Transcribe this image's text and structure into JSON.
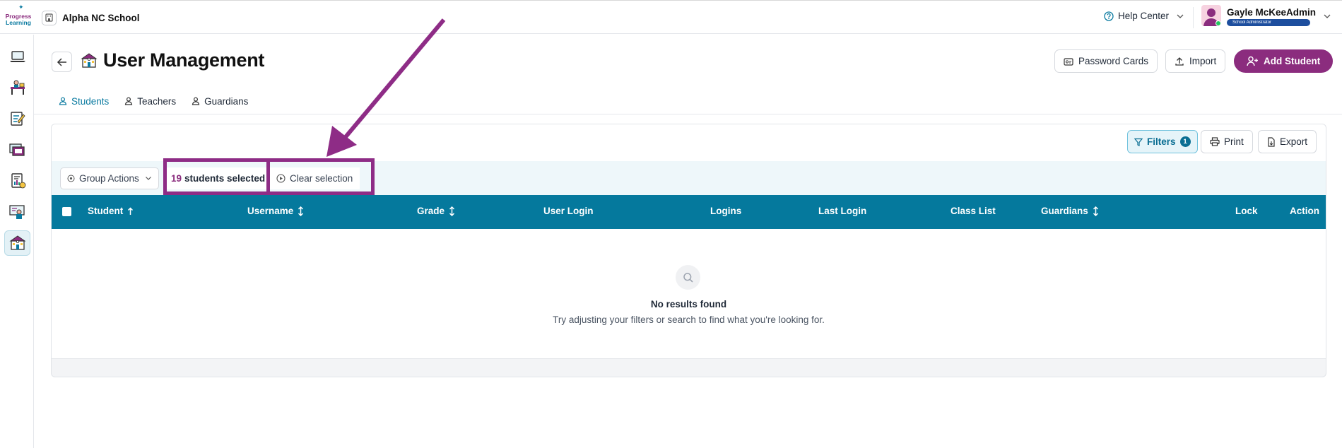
{
  "app": {
    "logo_line1": "Progress",
    "logo_line2": "Learning",
    "school_name": "Alpha NC School",
    "help_label": "Help Center",
    "user_name": "Gayle McKeeAdmin",
    "user_role": "School Administrator"
  },
  "sidebar": {
    "items": [
      {
        "icon": "laptop-icon"
      },
      {
        "icon": "classroom-desk-icon"
      },
      {
        "icon": "assignment-icon"
      },
      {
        "icon": "library-icon"
      },
      {
        "icon": "reports-icon"
      },
      {
        "icon": "teacher-icon"
      },
      {
        "icon": "school-building-icon",
        "active": true
      }
    ]
  },
  "header": {
    "title": "User Management",
    "password_cards_label": "Password Cards",
    "import_label": "Import",
    "add_student_label": "Add Student"
  },
  "tabs": [
    {
      "label": "Students",
      "active": true
    },
    {
      "label": "Teachers"
    },
    {
      "label": "Guardians"
    }
  ],
  "toolbar": {
    "filters_label": "Filters",
    "filters_count": "1",
    "print_label": "Print",
    "export_label": "Export"
  },
  "selection": {
    "group_actions_label": "Group Actions",
    "count": "19",
    "count_suffix": "students selected",
    "clear_label": "Clear selection"
  },
  "table": {
    "columns": [
      "Student",
      "Username",
      "Grade",
      "User Login",
      "Logins",
      "Last Login",
      "Class List",
      "Guardians",
      "Lock",
      "Action"
    ]
  },
  "empty_state": {
    "title": "No results found",
    "message": "Try adjusting your filters or search to find what you're looking for."
  },
  "colors": {
    "brand_purple": "#8b2c7e",
    "brand_teal": "#05799d",
    "annotation": "#8e2c86"
  }
}
